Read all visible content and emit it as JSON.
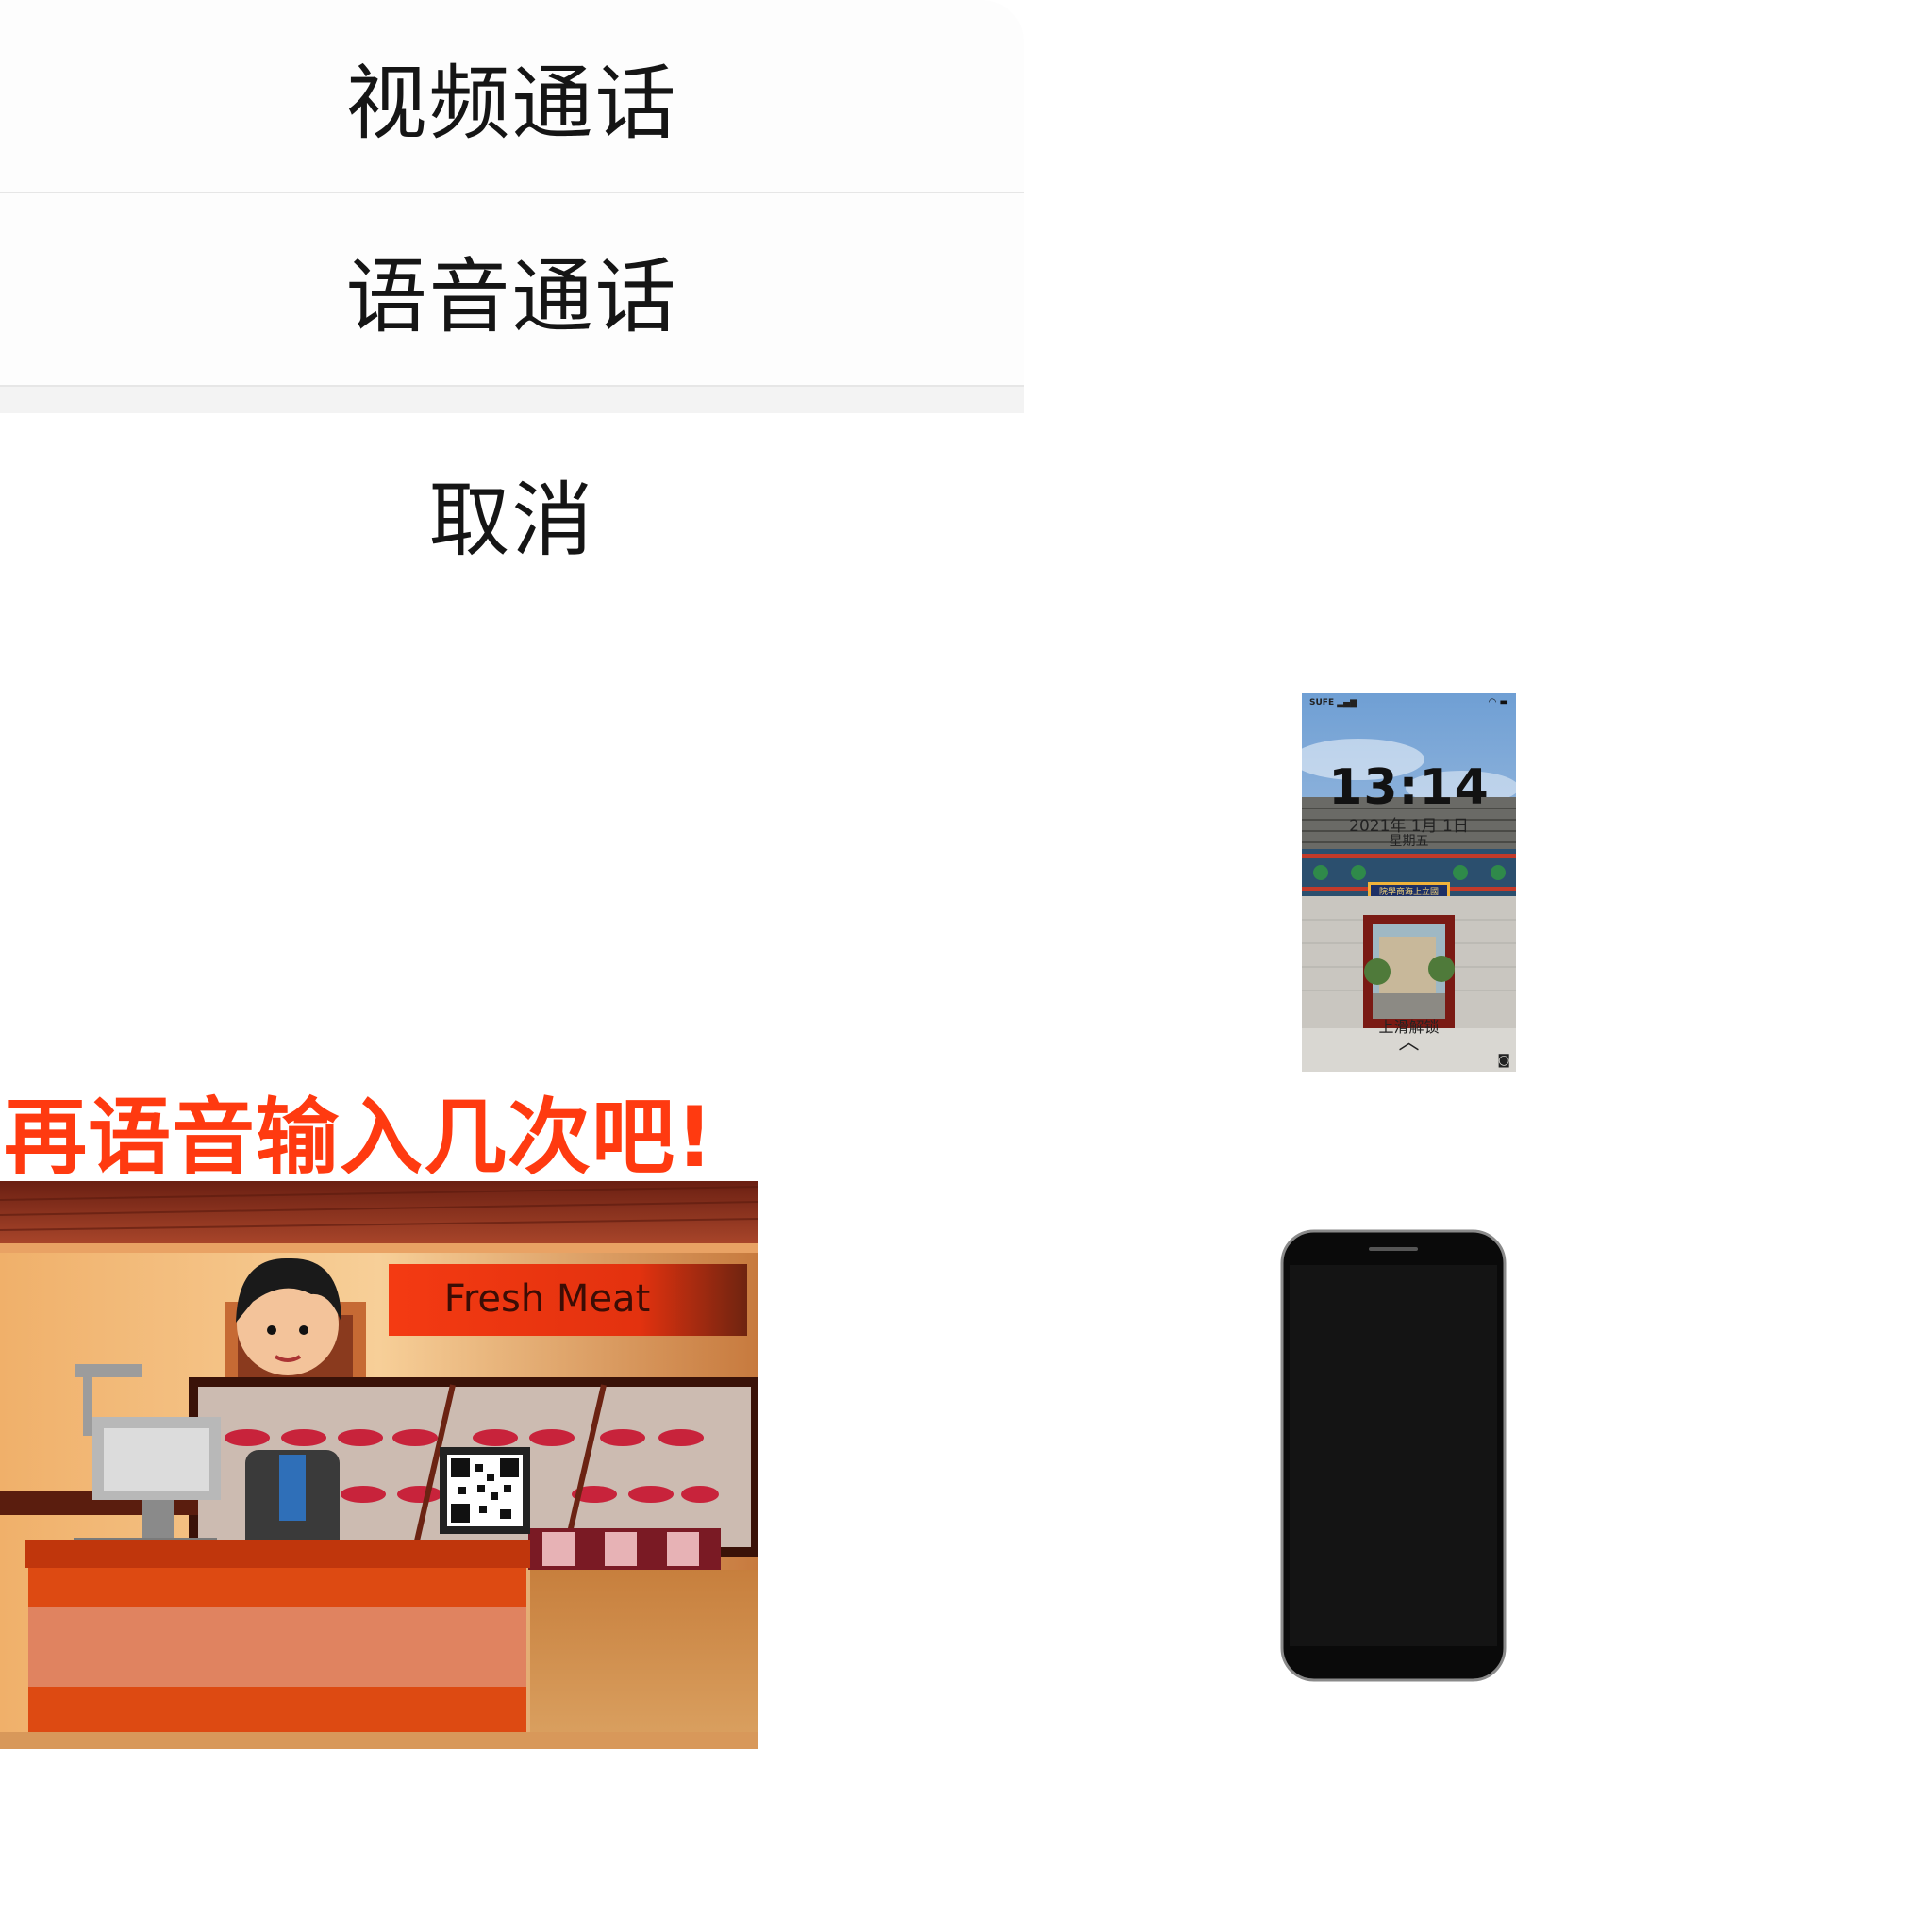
{
  "action_sheet": {
    "video_call": "视频通话",
    "voice_call": "语音通话",
    "cancel": "取消"
  },
  "promo": {
    "text": "再语音输入几次吧!",
    "color": "#ff3a10"
  },
  "illustration": {
    "sign": "Fresh Meat"
  },
  "lock_screen": {
    "carrier": "SUFE",
    "time": "13:14",
    "date": "2021年 1月 1日",
    "weekday": "星期五",
    "gate_plaque": "院學商海上立國",
    "unlock_hint": "上滑解锁"
  },
  "icons": [
    "signal-icon",
    "wifi-icon",
    "battery-icon",
    "chevron-up-icon",
    "camera-icon",
    "qr-code-icon"
  ]
}
